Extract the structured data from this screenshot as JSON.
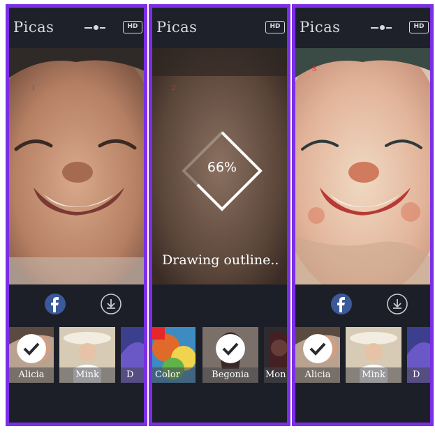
{
  "app": {
    "title": "Picas"
  },
  "colors": {
    "frame_border": "#7b2ee6",
    "background": "#1c1f28",
    "facebook": "#3b5998",
    "annotation": "#e8262a"
  },
  "panels": [
    {
      "annotation": "1",
      "hd_label": "HD",
      "filters": [
        {
          "label": "Alicia",
          "selected": true
        },
        {
          "label": "Mink",
          "selected": false
        },
        {
          "label": "D",
          "selected": false
        }
      ]
    },
    {
      "annotation": "2",
      "hd_label": "HD",
      "progress_percent": 66,
      "progress_text": "66%",
      "status_text": "Drawing outline..",
      "filters": [
        {
          "label": "Color",
          "selected": false
        },
        {
          "label": "Begonia",
          "selected": true
        },
        {
          "label": "Mon",
          "selected": false
        }
      ]
    },
    {
      "annotation": "3",
      "hd_label": "HD",
      "filters": [
        {
          "label": "Alicia",
          "selected": true
        },
        {
          "label": "Mink",
          "selected": false
        },
        {
          "label": "D",
          "selected": false
        }
      ]
    }
  ],
  "icons": {
    "slider": "slider-icon",
    "hd": "hd-icon",
    "facebook": "facebook-icon",
    "download": "download-icon",
    "check": "check-icon"
  }
}
